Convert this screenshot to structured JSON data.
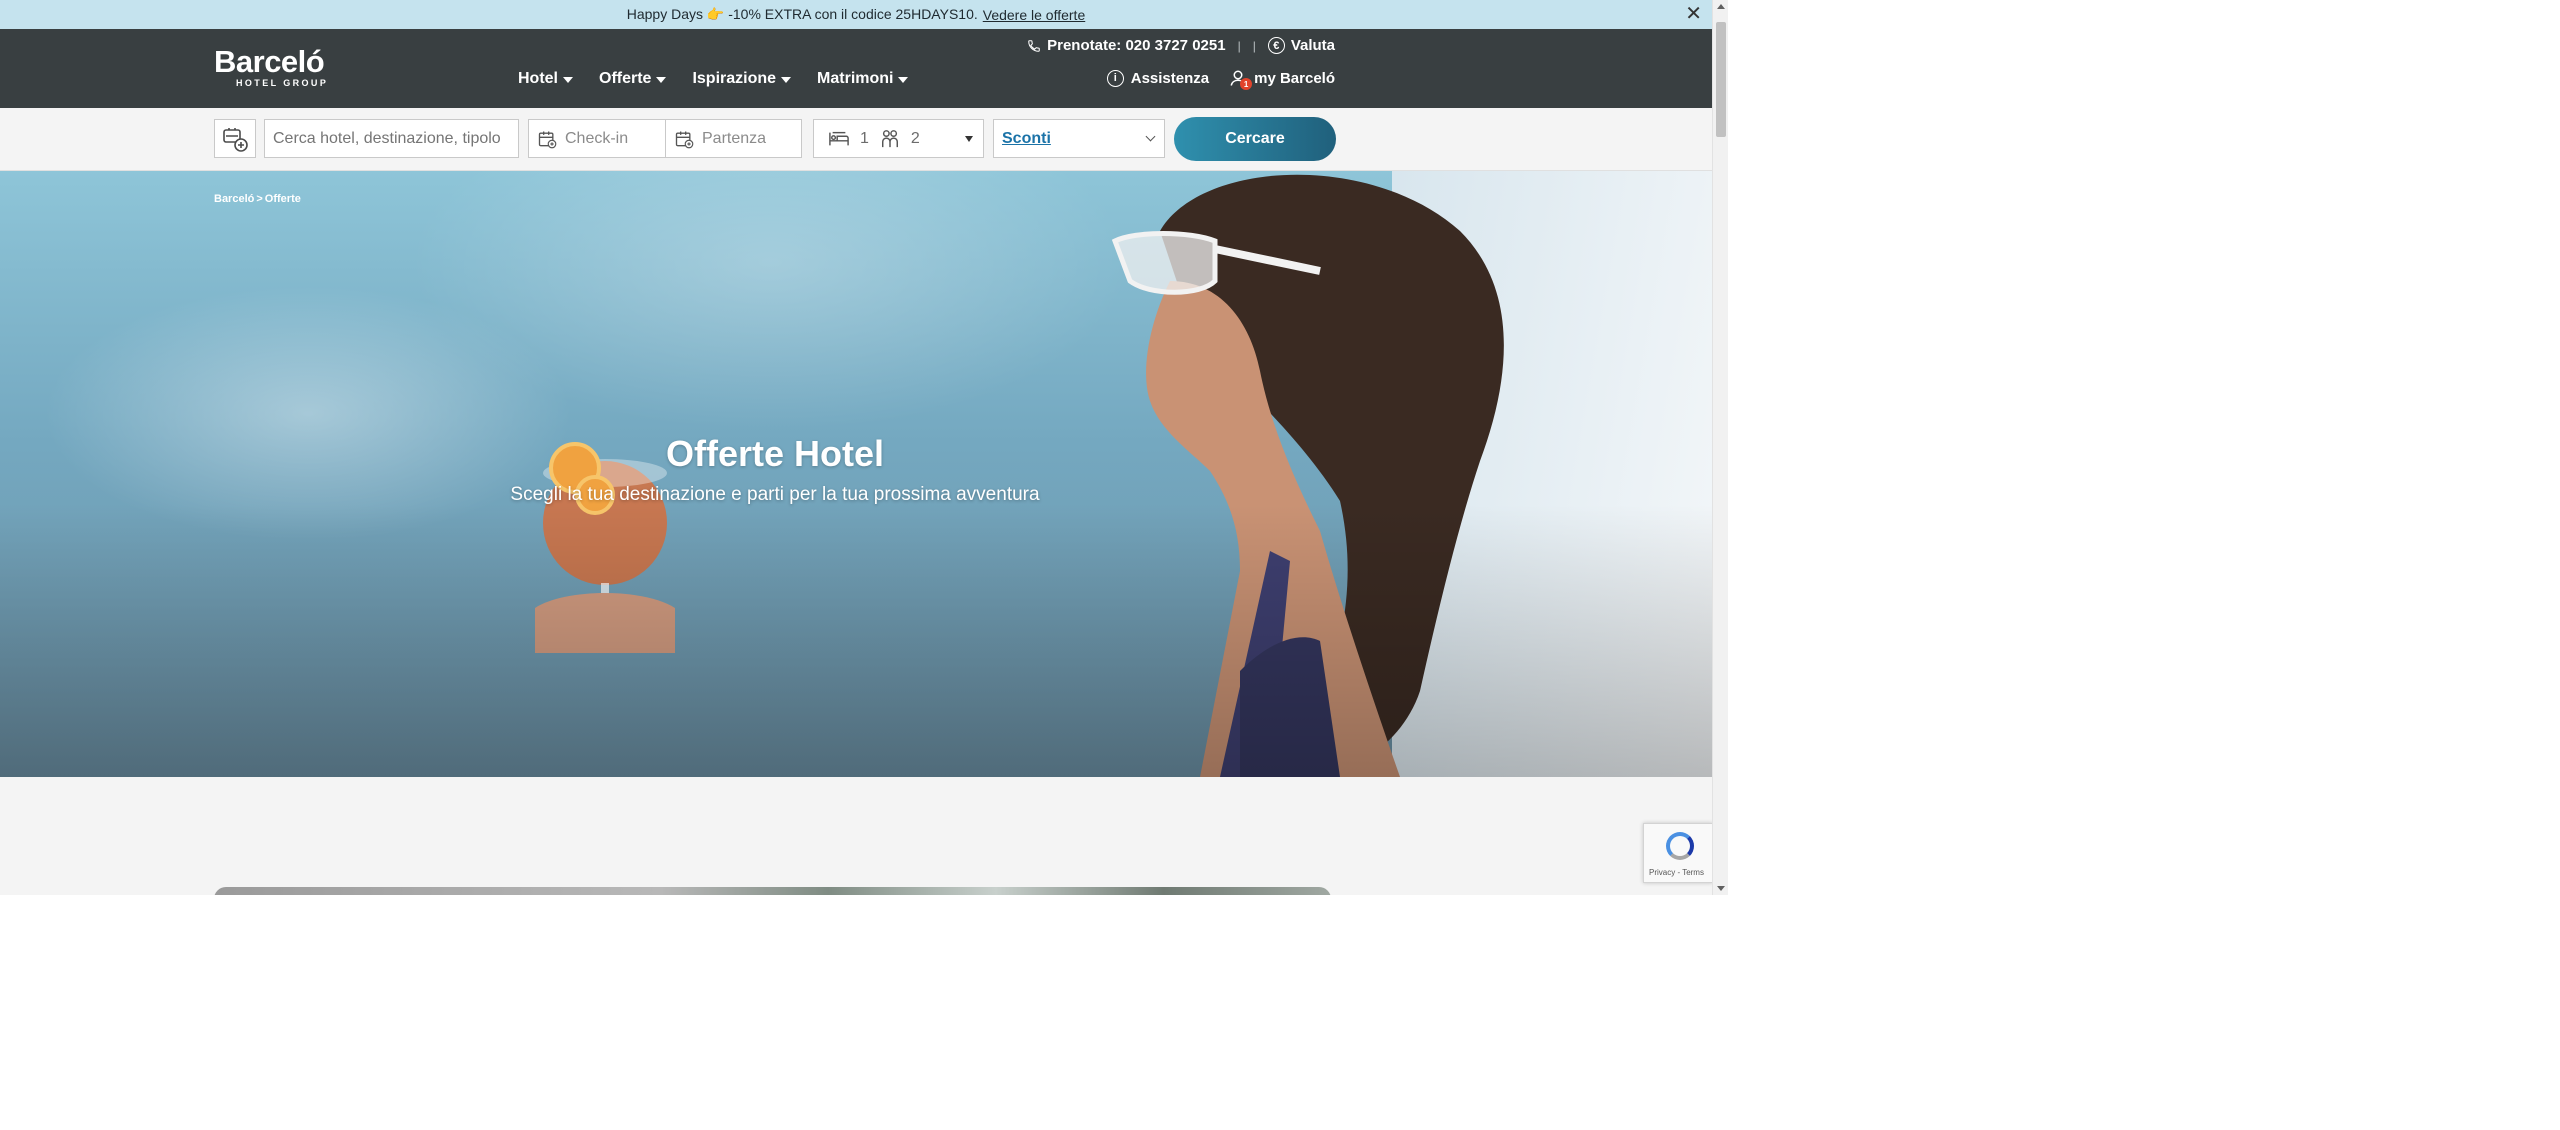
{
  "promo": {
    "text": "Happy Days 👉 -10% EXTRA con il codice 25HDAYS10.",
    "link": "Vedere le offerte",
    "close_icon": "✕"
  },
  "header": {
    "logo": {
      "brand": "Barceló",
      "sub": "HOTEL GROUP"
    },
    "nav": [
      {
        "label": "Hotel"
      },
      {
        "label": "Offerte"
      },
      {
        "label": "Ispirazione"
      },
      {
        "label": "Matrimoni"
      }
    ],
    "phone_label": "Prenotate: 020 3727 0251",
    "separator_1": "|",
    "separator_2": "|",
    "currency_label": "Valuta",
    "currency_symbol": "€",
    "help_label": "Assistenza",
    "help_symbol": "i",
    "account_label": "my Barceló",
    "account_badge": "1"
  },
  "search": {
    "destination_placeholder": "Cerca hotel, destinazione, tipolo",
    "checkin_placeholder": "Check-in",
    "checkout_placeholder": "Partenza",
    "rooms": "1",
    "guests": "2",
    "discount_label": "Sconti",
    "submit_label": "Cercare"
  },
  "hero": {
    "breadcrumb": [
      "Barceló",
      ">",
      "Offerte"
    ],
    "title": "Offerte Hotel",
    "subtitle": "Scegli la tua destinazione e parti per la tua prossima avventura"
  },
  "recaptcha": {
    "text": "Privacy - Terms"
  },
  "colors": {
    "promo_bg": "#c5e3ee",
    "header_bg": "#393f41",
    "button_gradient_start": "#2f90ae",
    "button_gradient_end": "#20607c",
    "link_blue": "#1b73a8"
  }
}
